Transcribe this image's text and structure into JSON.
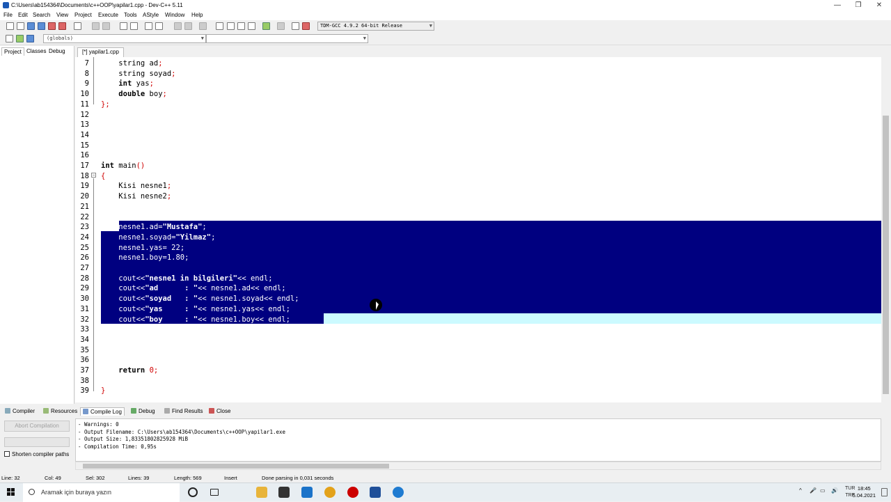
{
  "window": {
    "title": "C:\\Users\\ab154364\\Documents\\c++OOP\\yapilar1.cpp - Dev-C++ 5.11",
    "minimize_glyph": "—",
    "maximize_glyph": "❐",
    "close_glyph": "✕"
  },
  "menu": [
    "File",
    "Edit",
    "Search",
    "View",
    "Project",
    "Execute",
    "Tools",
    "AStyle",
    "Window",
    "Help"
  ],
  "toolbar": {
    "compiler_select": "TDM-GCC 4.9.2 64-bit Release",
    "globals_combo": "(globals)",
    "members_combo": ""
  },
  "left_panel": {
    "tabs": [
      "Project",
      "Classes",
      "Debug"
    ]
  },
  "editor": {
    "tab_label": "[*] yapilar1.cpp",
    "lines": [
      {
        "n": "7",
        "text": "    string ad;"
      },
      {
        "n": "8",
        "text": "    string soyad;"
      },
      {
        "n": "9",
        "text": "    int yas;"
      },
      {
        "n": "10",
        "text": "    double boy;"
      },
      {
        "n": "11",
        "text": "};"
      },
      {
        "n": "12",
        "text": ""
      },
      {
        "n": "13",
        "text": ""
      },
      {
        "n": "14",
        "text": ""
      },
      {
        "n": "15",
        "text": ""
      },
      {
        "n": "16",
        "text": ""
      },
      {
        "n": "17",
        "text": "int main()"
      },
      {
        "n": "18",
        "text": "{"
      },
      {
        "n": "19",
        "text": "    Kisi nesne1;"
      },
      {
        "n": "20",
        "text": "    Kisi nesne2;"
      },
      {
        "n": "21",
        "text": ""
      },
      {
        "n": "22",
        "text": ""
      },
      {
        "n": "23",
        "text": "    nesne1.ad=\"Mustafa\";"
      },
      {
        "n": "24",
        "text": "    nesne1.soyad=\"Yilmaz\";"
      },
      {
        "n": "25",
        "text": "    nesne1.yas= 22;"
      },
      {
        "n": "26",
        "text": "    nesne1.boy=1.80;"
      },
      {
        "n": "27",
        "text": ""
      },
      {
        "n": "28",
        "text": "    cout<<\"nesne1 in bilgileri\"<< endl;"
      },
      {
        "n": "29",
        "text": "    cout<<\"ad      : \"<< nesne1.ad<< endl;"
      },
      {
        "n": "30",
        "text": "    cout<<\"soyad   : \"<< nesne1.soyad<< endl;"
      },
      {
        "n": "31",
        "text": "    cout<<\"yas     : \"<< nesne1.yas<< endl;"
      },
      {
        "n": "32",
        "text": "    cout<<\"boy     : \"<< nesne1.boy<< endl;"
      },
      {
        "n": "33",
        "text": ""
      },
      {
        "n": "34",
        "text": ""
      },
      {
        "n": "35",
        "text": ""
      },
      {
        "n": "36",
        "text": ""
      },
      {
        "n": "37",
        "text": "    return 0;"
      },
      {
        "n": "38",
        "text": ""
      },
      {
        "n": "39",
        "text": "}"
      }
    ]
  },
  "bottom_tabs": [
    "Compiler",
    "Resources",
    "Compile Log",
    "Debug",
    "Find Results",
    "Close"
  ],
  "compile_panel": {
    "abort_label": "Abort Compilation",
    "shorten_label": "Shorten compiler paths",
    "log": [
      "- Warnings: 0",
      "- Output Filename: C:\\Users\\ab154364\\Documents\\c++OOP\\yapilar1.exe",
      "- Output Size: 1,83351802825928 MiB",
      "- Compilation Time: 0,95s"
    ]
  },
  "status": {
    "line": "Line:   32",
    "col": "Col:   49",
    "sel": "Sel:  302",
    "lines": "Lines:   39",
    "length": "Length:  569",
    "mode": "Insert",
    "message": "Done parsing in 0,031 seconds"
  },
  "taskbar": {
    "search_placeholder": "Aramak için buraya yazın",
    "lang_top": "TUR",
    "lang_bottom": "TRF",
    "time": "18:45",
    "date": "5.04.2021"
  }
}
